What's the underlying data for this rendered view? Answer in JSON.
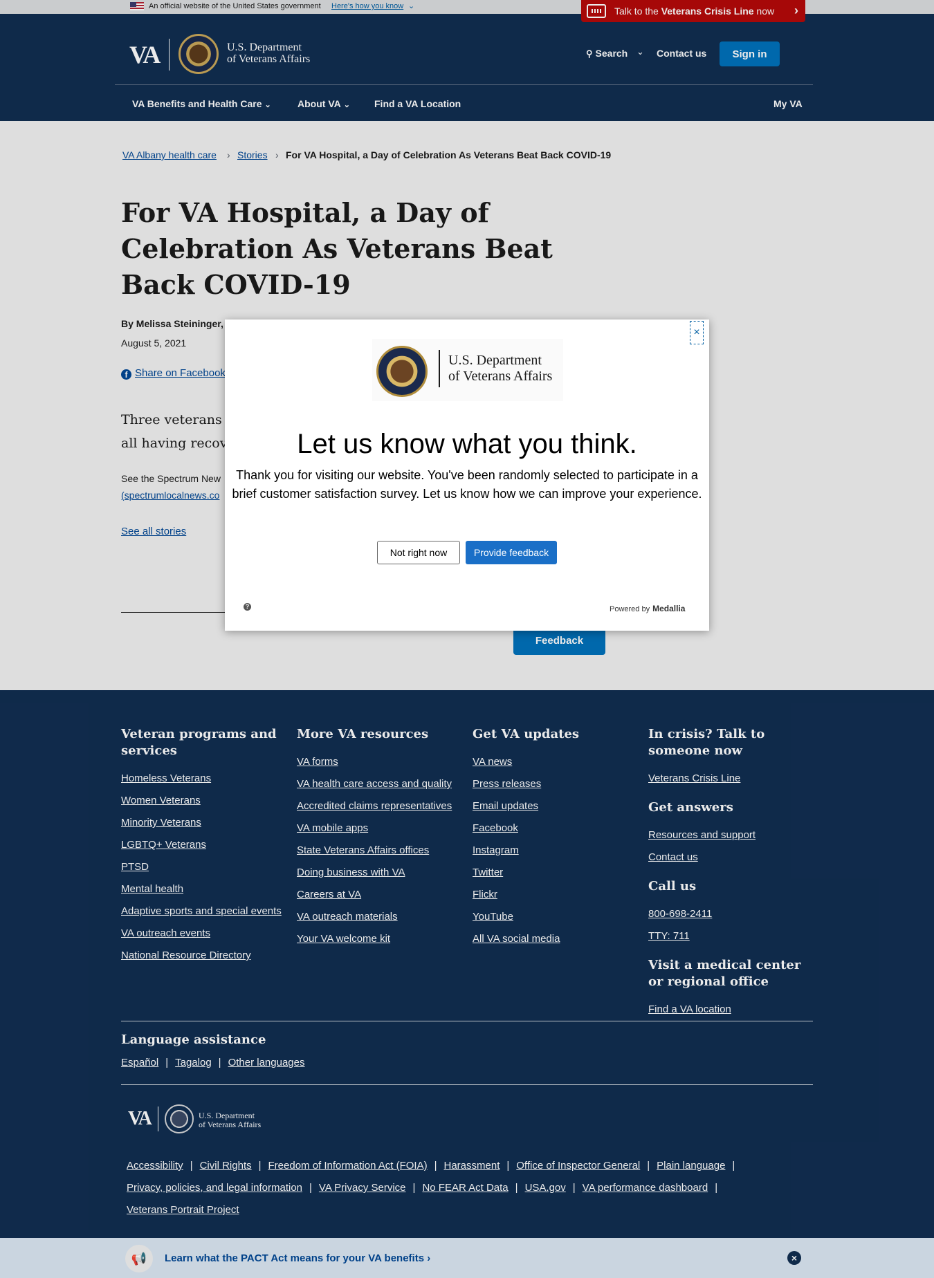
{
  "gov_banner": {
    "text": "An official website of the United States government",
    "link": "Here's how you know"
  },
  "crisis_bar": {
    "pre": "Talk to the ",
    "bold": "Veterans Crisis Line",
    "post": " now"
  },
  "header": {
    "logo_short": "VA",
    "dept_line1": "U.S. Department",
    "dept_line2": "of Veterans Affairs",
    "search": "Search",
    "contact": "Contact us",
    "signin": "Sign in",
    "nav": [
      "VA Benefits and Health Care",
      "About VA",
      "Find a VA Location",
      "My VA"
    ]
  },
  "breadcrumb": [
    "VA Albany health care",
    "Stories",
    "For VA Hospital, a Day of Celebration As Veterans Beat Back COVID-19"
  ],
  "article": {
    "title": "For VA Hospital, a Day of Celebration As Veterans Beat Back COVID-19",
    "byline": "By Melissa Steininger,",
    "date": "August 5, 2021",
    "share": "Share on Facebook",
    "lead": "Three veterans all having recov",
    "body": "See the Spectrum New",
    "body_link": "(spectrumlocalnews.co",
    "see_all": "See all stories",
    "feedback": "Feedback"
  },
  "modal": {
    "dept_line1": "U.S. Department",
    "dept_line2": "of Veterans Affairs",
    "heading": "Let us know what you think.",
    "message": "Thank you for visiting our website. You've been randomly selected to participate in a brief customer satisfaction survey. Let us know how we can improve your experience.",
    "not_now": "Not right now",
    "provide": "Provide feedback",
    "powered_by": "Powered by",
    "brand": "Medallia",
    "close": "×"
  },
  "footer": {
    "col1": {
      "heading": "Veteran programs and services",
      "links": [
        "Homeless Veterans",
        "Women Veterans",
        "Minority Veterans",
        "LGBTQ+ Veterans",
        "PTSD",
        "Mental health",
        "Adaptive sports and special events",
        "VA outreach events",
        "National Resource Directory"
      ]
    },
    "col2": {
      "heading": "More VA resources",
      "links": [
        "VA forms",
        "VA health care access and quality",
        "Accredited claims representatives",
        "VA mobile apps",
        "State Veterans Affairs offices",
        "Doing business with VA",
        "Careers at VA",
        "VA outreach materials",
        "Your VA welcome kit"
      ]
    },
    "col3": {
      "heading": "Get VA updates",
      "links": [
        "VA news",
        "Press releases",
        "Email updates",
        "Facebook",
        "Instagram",
        "Twitter",
        "Flickr",
        "YouTube",
        "All VA social media"
      ]
    },
    "col4": {
      "crisis_heading": "In crisis? Talk to someone now",
      "crisis_link": "Veterans Crisis Line",
      "answers_heading": "Get answers",
      "answers_links": [
        "Resources and support",
        "Contact us"
      ],
      "call_heading": "Call us",
      "call_links": [
        "800-698-2411",
        "TTY: 711"
      ],
      "visit_heading": "Visit a medical center or regional office",
      "visit_link": "Find a VA location"
    },
    "language": {
      "heading": "Language assistance",
      "links": [
        "Español",
        "Tagalog",
        "Other languages"
      ]
    },
    "logo_short": "VA",
    "dept_line1": "U.S. Department",
    "dept_line2": "of Veterans Affairs",
    "legal_row1": [
      "Accessibility",
      "Civil Rights",
      "Freedom of Information Act (FOIA)",
      "Harassment",
      "Office of Inspector General",
      "Plain language"
    ],
    "legal_row2": [
      "Privacy, policies, and legal information",
      "VA Privacy Service",
      "No FEAR Act Data",
      "USA.gov",
      "VA performance dashboard"
    ],
    "legal_row3": [
      "Veterans Portrait Project"
    ]
  },
  "pact": {
    "text": "Learn what the PACT Act means for your VA benefits",
    "chevron": "›",
    "close": "×"
  },
  "colors": {
    "navy": "#112e51",
    "link_blue": "#004795",
    "button_blue": "#0071bb",
    "crisis_red": "#b50909",
    "page_gray": "#f1f1f1"
  }
}
